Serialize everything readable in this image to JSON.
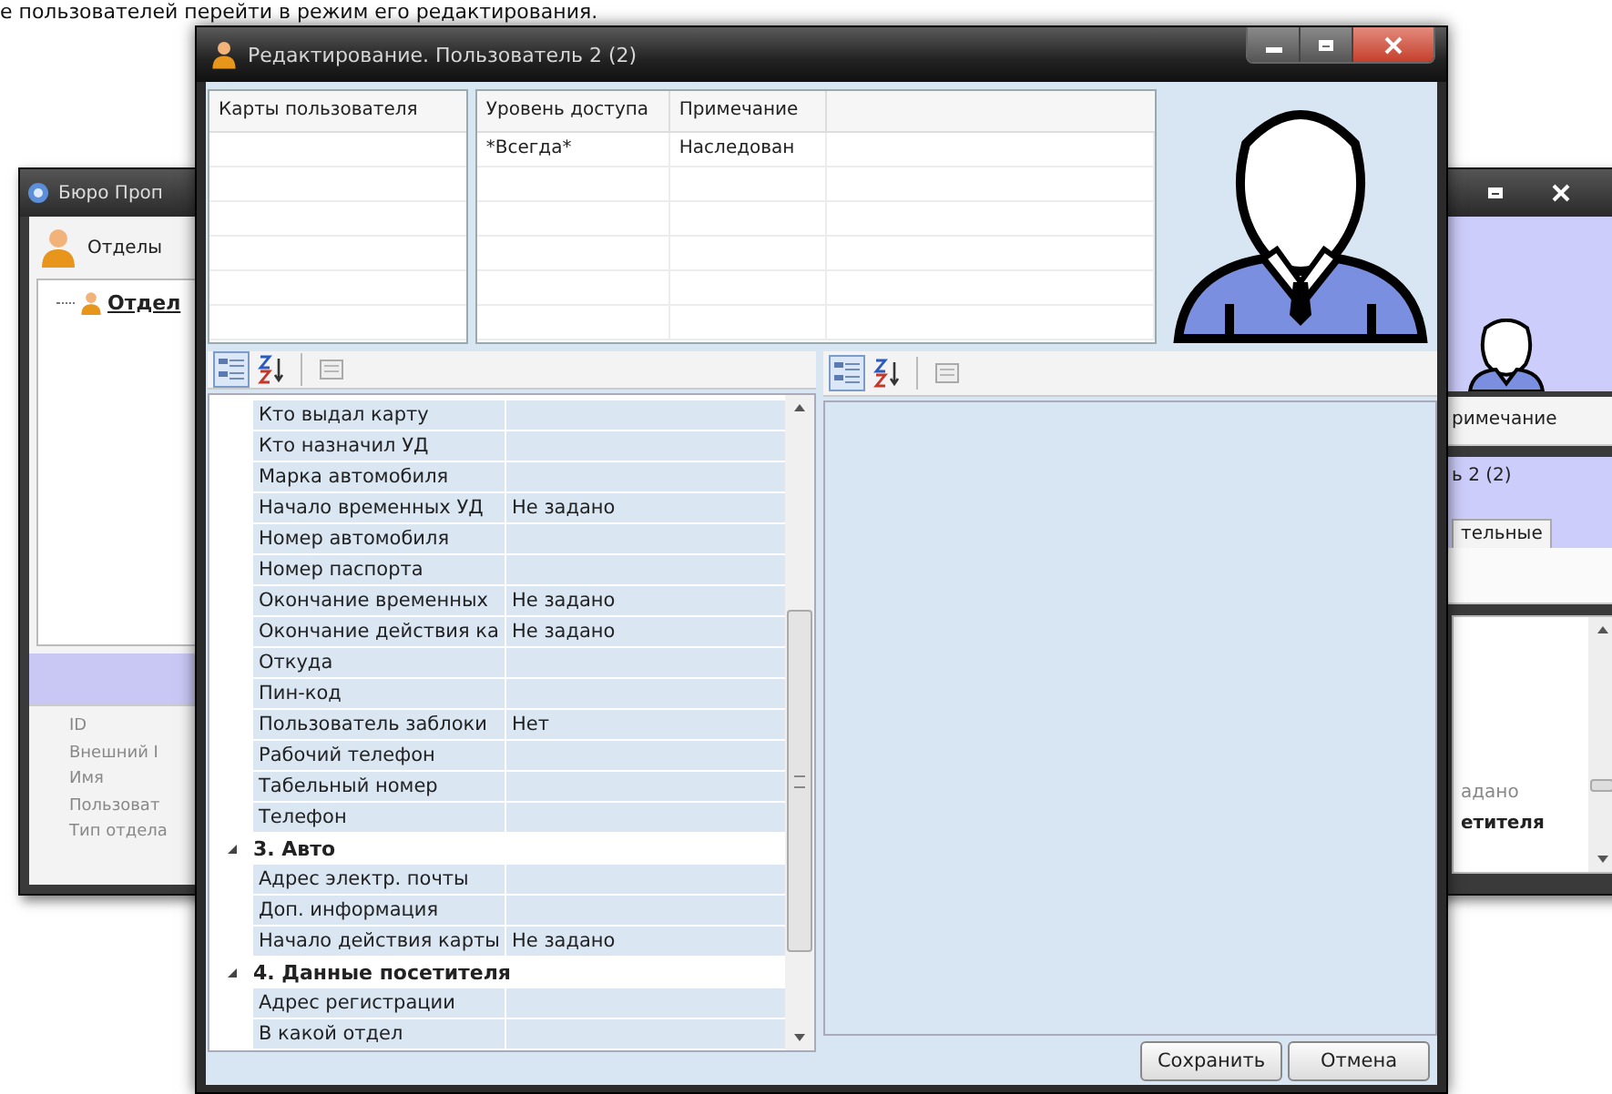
{
  "caption": "е пользователей перейти в режим его редактирования.",
  "back_left_window": {
    "title": "Бюро Проп",
    "tab": "Отделы",
    "tree_item": "Отдел",
    "properties": [
      "ID",
      "Внешний I",
      "Имя",
      "Пользоват",
      "Тип отдела"
    ]
  },
  "back_right_window": {
    "column": "римечание",
    "selected_title": "ь 2 (2)",
    "tab": "тельные",
    "values": [
      {
        "kind": "value",
        "text": "адано"
      },
      {
        "kind": "category",
        "text": "етителя"
      }
    ]
  },
  "window": {
    "title": "Редактирование. Пользователь 2 (2)"
  },
  "cards_table": {
    "columns": [
      "Карты пользователя"
    ]
  },
  "access_table": {
    "columns": [
      "Уровень доступа",
      "Примечание"
    ],
    "rows": [
      [
        "*Всегда*",
        "Наследован"
      ]
    ]
  },
  "property_grid": {
    "rows": [
      {
        "kind": "property",
        "name": "Кто выдал карту"
      },
      {
        "kind": "property",
        "name": "Кто назначил УД"
      },
      {
        "kind": "property",
        "name": "Марка автомобиля"
      },
      {
        "kind": "property",
        "name": "Начало временных УД",
        "value": "Не задано"
      },
      {
        "kind": "property",
        "name": "Номер автомобиля"
      },
      {
        "kind": "property",
        "name": "Номер паспорта"
      },
      {
        "kind": "property",
        "name": "Окончание временных",
        "value": "Не задано"
      },
      {
        "kind": "property",
        "name": "Окончание действия ка",
        "value": "Не задано"
      },
      {
        "kind": "property",
        "name": "Откуда"
      },
      {
        "kind": "property",
        "name": "Пин-код"
      },
      {
        "kind": "property",
        "name": "Пользователь заблоки",
        "value": "Нет"
      },
      {
        "kind": "property",
        "name": "Рабочий телефон"
      },
      {
        "kind": "property",
        "name": "Табельный номер"
      },
      {
        "kind": "property",
        "name": "Телефон"
      },
      {
        "kind": "category",
        "name": "3. Авто",
        "expanded": true
      },
      {
        "kind": "property",
        "name": "Адрес электр. почты"
      },
      {
        "kind": "property",
        "name": "Доп. информация"
      },
      {
        "kind": "property",
        "name": "Начало действия карты",
        "value": "Не задано"
      },
      {
        "kind": "category",
        "name": "4. Данные посетителя",
        "expanded": true
      },
      {
        "kind": "property",
        "name": "Адрес регистрации"
      },
      {
        "kind": "property",
        "name": "В какой отдел"
      }
    ]
  },
  "buttons": [
    "Сохранить",
    "Отмена"
  ]
}
